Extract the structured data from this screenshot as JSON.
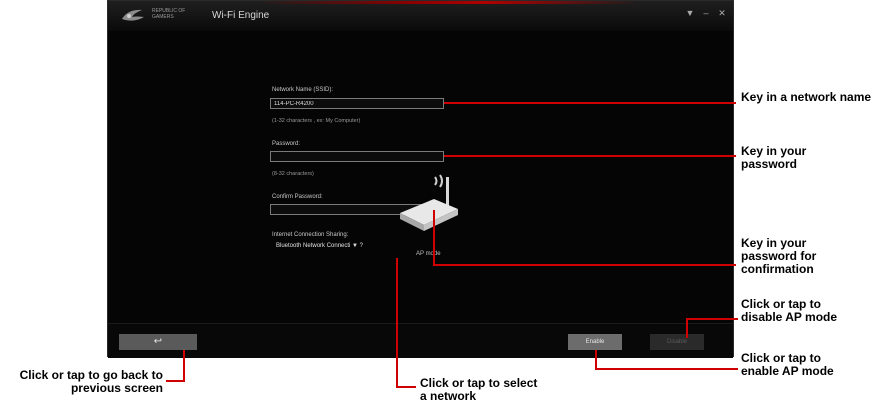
{
  "window": {
    "brand": "REPUBLIC OF GAMERS",
    "title": "Wi-Fi Engine",
    "menu_glyph": "▼",
    "min_glyph": "–",
    "close_glyph": "✕"
  },
  "form": {
    "ssid_label": "Network Name (SSID):",
    "ssid_value": "114-PC-R4200",
    "ssid_hint": "(1-32 characters , ex: My Computer)",
    "password_label": "Password:",
    "password_value": "",
    "password_hint": "(8-32 characters)",
    "confirm_label": "Confirm Password:",
    "confirm_value": "",
    "sharing_label": "Internet Connection Sharing:",
    "sharing_value": "Bluetooth Network Connecti ▼ ?"
  },
  "router": {
    "name": "AP mode"
  },
  "buttons": {
    "back": "↩",
    "enable": "Enable",
    "disable": "Disable"
  },
  "callouts": {
    "network_name": "Key in a network name",
    "password": "Key in your password",
    "confirm": "Key in your password for confirmation",
    "disable": "Click or tap to disable AP mode",
    "enable": "Click or tap to enable AP mode",
    "back": "Click or tap to go back to previous screen",
    "select_network": "Click or tap to select a network"
  },
  "colors": {
    "callout_line": "#d10000",
    "window_bg": "#050505",
    "accent": "#b00000"
  }
}
